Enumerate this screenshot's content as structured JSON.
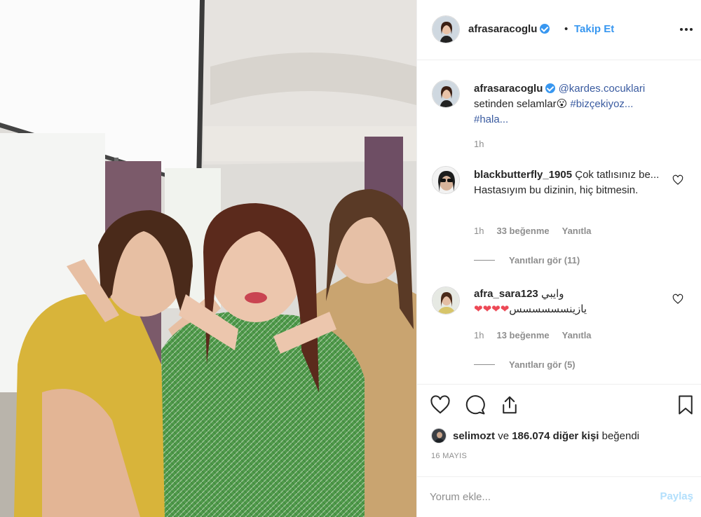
{
  "post": {
    "author": {
      "username": "afrasaracoglu",
      "verified": true
    },
    "separator": "•",
    "follow_label": "Takip Et",
    "more_icon": "more-horizontal-icon",
    "caption": {
      "username": "afrasaracoglu",
      "mention": "@kardes.cocuklari",
      "text": "setinden selamlar",
      "emoji": "😮",
      "hashtag_1": "#bizçekiyoz...",
      "hashtag_2": "#hala...",
      "time": "1h"
    },
    "comments": [
      {
        "username": "blackbutterfly_1905",
        "text": "Çok tatlısınız be... Hastasıyım bu dizinin, hiç bitmesin.",
        "time": "1h",
        "likes": "33 beğenme",
        "reply_label": "Yanıtla",
        "view_replies": "Yanıtları gör (11)"
      },
      {
        "username": "afra_sara123",
        "text": "وايبي",
        "text_line2": "يازينسسسسسس",
        "hearts": "❤❤❤❤",
        "time": "1h",
        "likes": "13 beğenme",
        "reply_label": "Yanıtla",
        "view_replies": "Yanıtları gör (5)"
      }
    ],
    "actions": {
      "like_icon": "heart-icon",
      "comment_icon": "comment-icon",
      "share_icon": "share-icon",
      "save_icon": "bookmark-icon"
    },
    "liked_by": {
      "username": "selimozt",
      "rest": "ve",
      "count_text": "186.074 diğer kişi",
      "suffix": "beğendi"
    },
    "date": "16 MAYIS",
    "comment_box": {
      "placeholder": "Yorum ekle...",
      "post_label": "Paylaş"
    }
  },
  "colors": {
    "accent": "#3897f0",
    "link": "#3a5ba0",
    "muted": "#8e8e8e",
    "heart": "#ed4956",
    "post_disabled": "#b2dffc"
  }
}
